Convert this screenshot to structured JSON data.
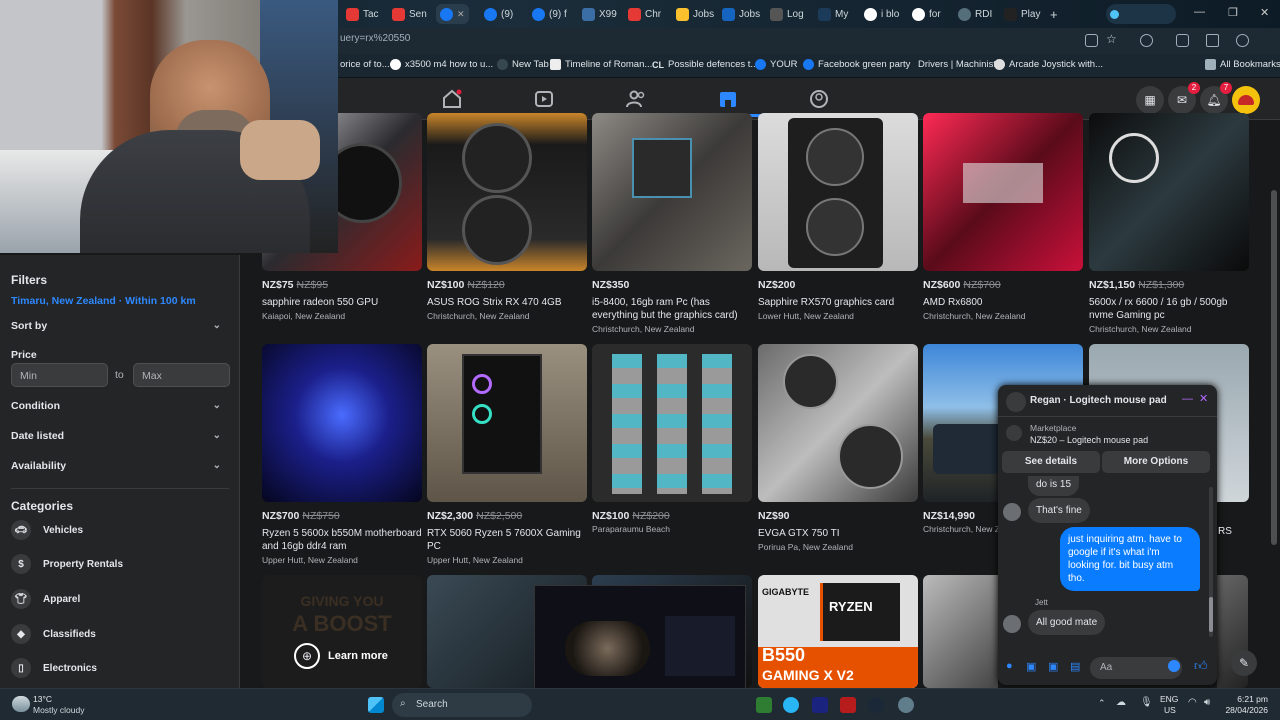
{
  "browser": {
    "tabs": [
      "Tac",
      "Sen",
      "",
      "(9)",
      "(9) f",
      "X99",
      "Chr",
      "Jobs",
      "Jobs",
      "Log",
      "My",
      "i blo",
      "for",
      "RDI",
      "Play"
    ],
    "url": "uery=rx%20550",
    "bookmarks": [
      "orice of to...",
      "x3500 m4 how to u...",
      "New Tab",
      "Timeline of Roman...",
      "Possible defences t...",
      "YOUR",
      "Facebook green party",
      "Drivers | Machinist",
      "Arcade Joystick with...",
      "All Bookmarks"
    ]
  },
  "nav": {
    "messenger_badge": "2",
    "notifications_badge": "7"
  },
  "sidebar": {
    "filters_title": "Filters",
    "location": "Timaru, New Zealand · Within 100 km",
    "sort_by": "Sort by",
    "price_label": "Price",
    "min_placeholder": "Min",
    "to_label": "to",
    "max_placeholder": "Max",
    "condition": "Condition",
    "date_listed": "Date listed",
    "availability": "Availability",
    "categories_title": "Categories",
    "categories": [
      "Vehicles",
      "Property Rentals",
      "Apparel",
      "Classifieds",
      "Electronics"
    ]
  },
  "listings_row1": [
    {
      "price": "NZ$75",
      "old": "NZ$95",
      "title": "sapphire radeon 550 GPU",
      "loc": "Kaiapoi, New Zealand"
    },
    {
      "price": "NZ$100",
      "old": "NZ$120",
      "title": "ASUS ROG Strix RX 470 4GB",
      "loc": "Christchurch, New Zealand"
    },
    {
      "price": "NZ$350",
      "old": "",
      "title": "i5-8400, 16gb ram Pc (has everything but the graphics card)",
      "loc": "Christchurch, New Zealand"
    },
    {
      "price": "NZ$200",
      "old": "",
      "title": "Sapphire RX570 graphics card",
      "loc": "Lower Hutt, New Zealand"
    },
    {
      "price": "NZ$600",
      "old": "NZ$700",
      "title": "AMD Rx6800",
      "loc": "Christchurch, New Zealand"
    },
    {
      "price": "NZ$1,150",
      "old": "NZ$1,300",
      "title": "5600x / rx 6600 / 16 gb / 500gb nvme Gaming pc",
      "loc": "Christchurch, New Zealand"
    }
  ],
  "listings_row2": [
    {
      "price": "NZ$700",
      "old": "NZ$750",
      "title": "Ryzen 5 5600x b550M motherboard and 16gb ddr4 ram",
      "loc": "Upper Hutt, New Zealand"
    },
    {
      "price": "NZ$2,300",
      "old": "NZ$2,500",
      "title": "RTX 5060 Ryzen 5 7600X Gaming PC",
      "loc": "Upper Hutt, New Zealand"
    },
    {
      "price": "NZ$100",
      "old": "NZ$200",
      "title": "",
      "loc": "Paraparaumu Beach"
    },
    {
      "price": "NZ$90",
      "old": "",
      "title": "EVGA GTX 750 TI",
      "loc": "Porirua Pa, New Zealand"
    },
    {
      "price": "NZ$14,990",
      "old": "",
      "title": "",
      "loc": "Christchurch, New Ze"
    }
  ],
  "row3": {
    "ad_text1": "GIVING YOU",
    "ad_text2": "A BOOST",
    "learn_more": "Learn more",
    "gigabyte": "GIGABYTE",
    "ryzen": "RYZEN",
    "b550": "B550",
    "gaming": "GAMING X V2"
  },
  "chat": {
    "title": "Regan · Logitech mouse pad",
    "marketplace": "Marketplace",
    "item": "NZ$20 – Logitech mouse pad",
    "see_details": "See details",
    "more_options": "More Options",
    "msg1": "do is 15",
    "msg2": "That's fine",
    "msg3": "just inquiring atm. have to google if it's what i'm looking for. bit busy atm tho.",
    "sender": "Jett",
    "msg4": "All good mate",
    "input_placeholder": "Aa",
    "partial_rs": "RS"
  },
  "taskbar": {
    "temp": "13°C",
    "weather": "Mostly cloudy",
    "search": "Search",
    "lang1": "ENG",
    "lang2": "US",
    "time": "6:21 pm",
    "date": "28/04/2026"
  }
}
